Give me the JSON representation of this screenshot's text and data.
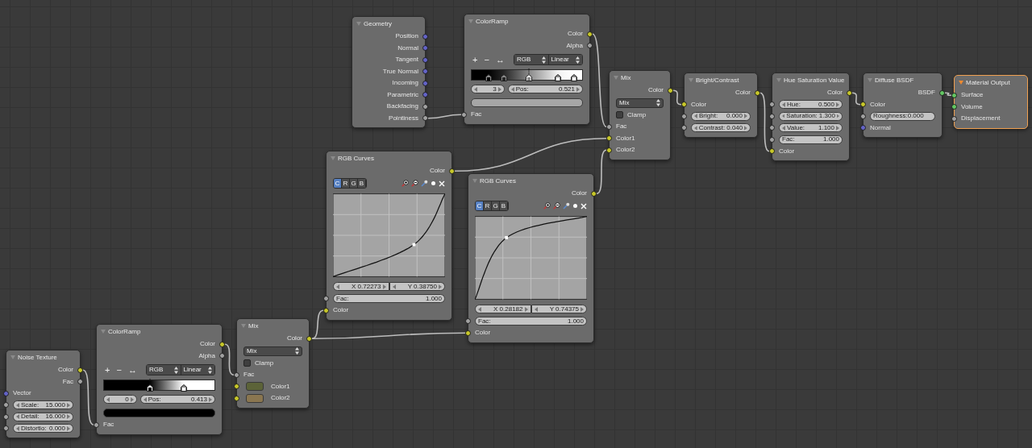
{
  "nodes": [
    {
      "title": "Geometry",
      "active": false,
      "rows": [
        {
          "kind": "output",
          "label": "Position",
          "socket": {
            "color": "#6363c7"
          }
        },
        {
          "kind": "output",
          "label": "Normal",
          "socket": {
            "color": "#6363c7"
          }
        },
        {
          "kind": "output",
          "label": "Tangent",
          "socket": {
            "color": "#6363c7"
          }
        },
        {
          "kind": "output",
          "label": "True Normal",
          "socket": {
            "color": "#6363c7"
          }
        },
        {
          "kind": "output",
          "label": "Incoming",
          "socket": {
            "color": "#6363c7"
          }
        },
        {
          "kind": "output",
          "label": "Parametric",
          "socket": {
            "color": "#6363c7"
          }
        },
        {
          "kind": "output",
          "label": "Backfacing",
          "socket": {
            "color": "#a1a1a1"
          }
        },
        {
          "kind": "output",
          "label": "Pointiness",
          "socket": {
            "color": "#a1a1a1"
          }
        }
      ]
    },
    {
      "title": "ColorRamp",
      "active": false,
      "rows": [
        {
          "kind": "output",
          "label": "Color",
          "socket": {
            "color": "#c7c729"
          }
        },
        {
          "kind": "output",
          "label": "Alpha",
          "socket": {
            "color": "#a1a1a1"
          }
        },
        {
          "kind": "ramp_toolbar",
          "buttons": [
            "+",
            "−",
            "↔"
          ],
          "mode": "RGB",
          "interpolation": "Linear"
        },
        {
          "kind": "ramp",
          "stops": [
            {
              "level": 0.15,
              "color": "#000000",
              "selected": false
            },
            {
              "level": 0.29,
              "color": "#262626",
              "selected": false
            },
            {
              "level": 0.521,
              "color": "#8a8a8a",
              "selected": true
            },
            {
              "level": 0.78,
              "color": "#f2f2f2",
              "selected": false
            },
            {
              "level": 0.93,
              "color": "#ffffff",
              "selected": false
            }
          ]
        },
        {
          "kind": "ramp_fields",
          "index": "3",
          "label": "Pos:",
          "value": "0.521"
        },
        {
          "kind": "color_field",
          "color": "#a6a6a6"
        },
        {
          "kind": "input",
          "label": "Fac",
          "socket": {
            "color": "#a1a1a1"
          }
        }
      ]
    },
    {
      "title": "Mix",
      "active": false,
      "rows": [
        {
          "kind": "output",
          "label": "Color",
          "socket": {
            "color": "#c7c729"
          }
        },
        {
          "kind": "dropdown",
          "value": "Mix"
        },
        {
          "kind": "checkbox",
          "label": "Clamp",
          "checked": false
        },
        {
          "kind": "input",
          "label": "Fac",
          "socket": {
            "color": "#a1a1a1"
          }
        },
        {
          "kind": "input",
          "label": "Color1",
          "socket": {
            "color": "#c7c729"
          }
        },
        {
          "kind": "input",
          "label": "Color2",
          "socket": {
            "color": "#c7c729"
          }
        }
      ]
    },
    {
      "title": "Bright/Contrast",
      "active": false,
      "rows": [
        {
          "kind": "output",
          "label": "Color",
          "socket": {
            "color": "#c7c729"
          }
        },
        {
          "kind": "input",
          "label": "Color",
          "socket": {
            "color": "#c7c729"
          }
        },
        {
          "kind": "field",
          "label": "Bright:",
          "value": "0.000",
          "arrows": true,
          "socket": {
            "color": "#a1a1a1"
          }
        },
        {
          "kind": "field",
          "label": "Contrast:",
          "value": "0.040",
          "arrows": true,
          "socket": {
            "color": "#a1a1a1"
          }
        }
      ]
    },
    {
      "title": "Hue Saturation Value",
      "active": false,
      "rows": [
        {
          "kind": "output",
          "label": "Color",
          "socket": {
            "color": "#c7c729"
          }
        },
        {
          "kind": "field",
          "label": "Hue:",
          "value": "0.500",
          "arrows": true,
          "socket": {
            "color": "#a1a1a1"
          }
        },
        {
          "kind": "field",
          "label": "Saturation:",
          "value": "1.300",
          "arrows": true,
          "socket": {
            "color": "#a1a1a1"
          }
        },
        {
          "kind": "field",
          "label": "Value:",
          "value": "1.100",
          "arrows": true,
          "socket": {
            "color": "#a1a1a1"
          }
        },
        {
          "kind": "field",
          "label": "Fac:",
          "value": "1.000",
          "arrows": false,
          "socket": {
            "color": "#a1a1a1"
          }
        },
        {
          "kind": "input",
          "label": "Color",
          "socket": {
            "color": "#c7c729"
          }
        }
      ]
    },
    {
      "title": "Diffuse BSDF",
      "active": false,
      "rows": [
        {
          "kind": "output",
          "label": "BSDF",
          "socket": {
            "color": "#63c763"
          }
        },
        {
          "kind": "input",
          "label": "Color",
          "socket": {
            "color": "#c7c729"
          }
        },
        {
          "kind": "field",
          "label": "Roughness:0.000",
          "arrows": false,
          "socket": {
            "color": "#a1a1a1"
          }
        },
        {
          "kind": "input",
          "label": "Normal",
          "socket": {
            "color": "#6363c7"
          }
        }
      ]
    },
    {
      "title": "Material Output",
      "active": true,
      "rows": [
        {
          "kind": "input",
          "label": "Surface",
          "socket": {
            "color": "#63c763"
          }
        },
        {
          "kind": "input",
          "label": "Volume",
          "socket": {
            "color": "#63c763"
          }
        },
        {
          "kind": "input",
          "label": "Displacement",
          "socket": {
            "color": "#a1a1a1"
          }
        }
      ]
    },
    {
      "title": "RGB Curves",
      "active": false,
      "rows": [
        {
          "kind": "output",
          "label": "Color",
          "socket": {
            "color": "#c7c729"
          }
        },
        {
          "kind": "curve_toolbar",
          "channels": [
            {
              "label": "C",
              "selected": true
            },
            {
              "label": "R",
              "selected": false
            },
            {
              "label": "G",
              "selected": false
            },
            {
              "label": "B",
              "selected": false
            }
          ]
        },
        {
          "kind": "curve"
        },
        {
          "kind": "xy_fields",
          "x": "X 0.72273",
          "y": "Y 0.38750"
        },
        {
          "kind": "field",
          "label": "Fac:",
          "value": "1.000",
          "arrows": false,
          "socket": {
            "color": "#a1a1a1"
          }
        },
        {
          "kind": "input",
          "label": "Color",
          "socket": {
            "color": "#c7c729"
          }
        }
      ]
    },
    {
      "title": "RGB Curves",
      "active": false,
      "rows": [
        {
          "kind": "output",
          "label": "Color",
          "socket": {
            "color": "#c7c729"
          }
        },
        {
          "kind": "curve_toolbar",
          "channels": [
            {
              "label": "C",
              "selected": true
            },
            {
              "label": "R",
              "selected": false
            },
            {
              "label": "G",
              "selected": false
            },
            {
              "label": "B",
              "selected": false
            }
          ]
        },
        {
          "kind": "curve"
        },
        {
          "kind": "xy_fields",
          "x": "X 0.28182",
          "y": "Y 0.74375"
        },
        {
          "kind": "field",
          "label": "Fac:",
          "value": "1.000",
          "arrows": false,
          "socket": {
            "color": "#a1a1a1"
          }
        },
        {
          "kind": "input",
          "label": "Color",
          "socket": {
            "color": "#c7c729"
          }
        }
      ]
    },
    {
      "title": "Noise Texture",
      "active": false,
      "rows": [
        {
          "kind": "output",
          "label": "Color",
          "socket": {
            "color": "#c7c729"
          }
        },
        {
          "kind": "output",
          "label": "Fac",
          "socket": {
            "color": "#a1a1a1"
          }
        },
        {
          "kind": "input",
          "label": "Vector",
          "socket": {
            "color": "#6363c7"
          }
        },
        {
          "kind": "field",
          "label": "Scale:",
          "value": "15.000",
          "arrows": true,
          "socket": {
            "color": "#a1a1a1"
          }
        },
        {
          "kind": "field",
          "label": "Detail:",
          "value": "16.000",
          "arrows": true,
          "socket": {
            "color": "#a1a1a1"
          }
        },
        {
          "kind": "field",
          "label": "Distortio:",
          "value": "0.000",
          "arrows": true,
          "socket": {
            "color": "#a1a1a1"
          }
        }
      ]
    },
    {
      "title": "ColorRamp",
      "active": false,
      "rows": [
        {
          "kind": "output",
          "label": "Color",
          "socket": {
            "color": "#c7c729"
          }
        },
        {
          "kind": "output",
          "label": "Alpha",
          "socket": {
            "color": "#a1a1a1"
          }
        },
        {
          "kind": "ramp_toolbar",
          "buttons": [
            "+",
            "−",
            "↔"
          ],
          "mode": "RGB",
          "interpolation": "Linear"
        },
        {
          "kind": "ramp",
          "stops": [
            {
              "level": 0.413,
              "color": "#000000",
              "selected": true
            },
            {
              "level": 0.72,
              "color": "#ffffff",
              "selected": false
            }
          ]
        },
        {
          "kind": "ramp_fields",
          "index": "0",
          "label": "Pos:",
          "value": "0.413"
        },
        {
          "kind": "color_field",
          "color": "#000000"
        },
        {
          "kind": "input",
          "label": "Fac",
          "socket": {
            "color": "#a1a1a1"
          }
        }
      ]
    },
    {
      "title": "Mix",
      "active": false,
      "rows": [
        {
          "kind": "output",
          "label": "Color",
          "socket": {
            "color": "#c7c729"
          }
        },
        {
          "kind": "dropdown",
          "value": "Mix"
        },
        {
          "kind": "checkbox",
          "label": "Clamp",
          "checked": false
        },
        {
          "kind": "input",
          "label": "Fac",
          "socket": {
            "color": "#a1a1a1"
          }
        },
        {
          "kind": "swatch_input",
          "label": "Color1",
          "socket": {
            "color": "#c7c729"
          },
          "color": "#5c6338"
        },
        {
          "kind": "swatch_input",
          "label": "Color2",
          "socket": {
            "color": "#c7c729"
          },
          "color": "#8a7650"
        }
      ]
    }
  ]
}
